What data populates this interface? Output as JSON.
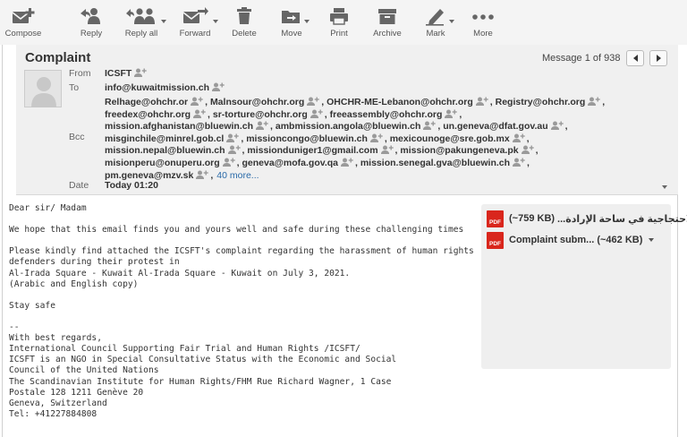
{
  "toolbar": {
    "compose": "Compose",
    "reply": "Reply",
    "reply_all": "Reply all",
    "forward": "Forward",
    "delete": "Delete",
    "move": "Move",
    "print": "Print",
    "archive": "Archive",
    "mark": "Mark",
    "more": "More"
  },
  "message": {
    "subject": "Complaint",
    "counter": "Message 1 of 938",
    "labels": {
      "from": "From",
      "to": "To",
      "bcc": "Bcc",
      "date": "Date"
    },
    "from": "ICSFT",
    "to": "info@kuwaitmission.ch",
    "bcc_lines": [
      [
        "Relhage@ohchr.or",
        "Malnsour@ohchr.org",
        "OHCHR-ME-Lebanon@ohchr.org",
        "Registry@ohchr.org"
      ],
      [
        "freedex@ohchr.org",
        "sr-torture@ohchr.org",
        "freeassembly@ohchr.org"
      ],
      [
        "mission.afghanistan@bluewin.ch",
        "ambmission.angola@bluewin.ch",
        "un.geneva@dfat.gov.au"
      ],
      [
        "misginchile@minrel.gob.cl",
        "missioncongo@bluewin.ch",
        "mexicounoge@sre.gob.mx"
      ],
      [
        "mission.nepal@bluewin.ch",
        "missionduniger1@gmail.com",
        "mission@pakungeneva.pk"
      ],
      [
        "misionperu@onuperu.org",
        "geneva@mofa.gov.qa",
        "mission.senegal.gva@bluewin.ch"
      ],
      [
        "pm.geneva@mzv.sk"
      ]
    ],
    "more_recipients": "40 more...",
    "date": "Today 01:20"
  },
  "body": {
    "lines": [
      "Dear sir/ Madam",
      "",
      "We hope that this email finds you and yours well and safe during these challenging times",
      "",
      "Please kindly find attached the ICSFT's complaint regarding the harassment of human rights",
      "defenders during their protest in",
      "Al-Irada Square - Kuwait Al-Irada Square - Kuwait on July 3, 2021.",
      "(Arabic and English copy)",
      "",
      "Stay safe",
      "",
      "--",
      "With best regards,",
      "International Council Supporting Fair Trial and Human Rights /ICSFT/",
      "ICSFT is an NGO in Special Consultative Status with the Economic and Social",
      "Council of the United Nations",
      "The Scandinavian Institute for Human Rights/FHM Rue Richard Wagner, 1 Case",
      "Postale 128 1211 Genève 20",
      "Geneva, Switzerland",
      "Tel: +41227884808"
    ]
  },
  "attachments": [
    {
      "name": "...الاحتجاجية في ساحة الإرادة",
      "size": "(~759 KB)",
      "type": "PDF"
    },
    {
      "name": "Complaint subm...",
      "size": "(~462 KB)",
      "type": "PDF"
    }
  ],
  "colors": {
    "toolbar_bg": "#f4f4f4",
    "header_bg": "#f0f0f0",
    "link": "#2a6aa8",
    "pdf_red": "#d9261c"
  }
}
